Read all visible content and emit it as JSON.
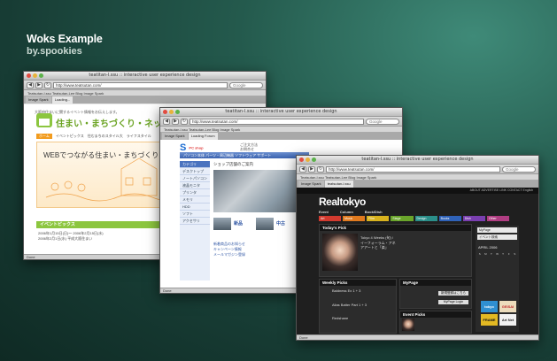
{
  "hero": {
    "title": "Woks Example",
    "subtitle": "by.spookies"
  },
  "windows": [
    {
      "title": "teatitan-l.ssu :: interactive user experience design",
      "url": "http://www.teatsutan.com/",
      "search": "Google",
      "bookmarks": "Teatsutan-l.ssu    Teatsutan-Lee Blog    Image Spark",
      "tabs": [
        "Image Spark",
        "Loading..."
      ],
      "status": "Done",
      "page": {
        "header_note": "大阪府住まいに関するイベント情報をお伝えします。",
        "brand": "住まい・まちづくり・ネット",
        "nav": [
          "ホーム",
          "イベントピックス",
          "住むまちのスタイル大",
          "ライフスタイル"
        ],
        "hero_text": "WEBでつながる住まい・まちづくり",
        "section": "イベントピックス",
        "news": [
          "2006年1月15日(日)〜 2006年2月15日(水)",
          "2006年2月1日(水) 平成大阪住まい"
        ]
      }
    },
    {
      "title": "teatitan-l.ssu :: interactive user experience design",
      "url": "http://www.teatsutan.com/",
      "search": "Google",
      "bookmarks": "Teatsutan-l.ssu    Teatsutan-Lee Blog    Image Spark",
      "tabs": [
        "Image Spark",
        "Loading Forum"
      ],
      "status": "Done",
      "page": {
        "logo": "S",
        "logo_tag": "PC shop",
        "top_links": [
          "ご注文方法",
          "お問合せ"
        ],
        "navbar": "パソコン本体   パーツ・周辺機器   ソフトウェア   サポート",
        "side_header": "カテゴリ",
        "side": [
          "デスクトップ",
          "ノートパソコン",
          "液晶モニタ",
          "プリンタ",
          "メモリ",
          "HDD",
          "ソフト",
          "アクセサリ"
        ],
        "photo_title": "ショップ店舗のご案内",
        "tiles": [
          "新品",
          "中古"
        ],
        "news": [
          "新着商品のお知らせ",
          "キャンペーン情報",
          "メールマガジン登録"
        ]
      }
    },
    {
      "title": "teatitan-l.ssu :: interactive user experience design",
      "url": "http://www.teatsutan.com/",
      "search": "Google",
      "bookmarks": "Teatsutan-l.ssu    Teatsutan-Lee Blog    Image Spark",
      "tabs": [
        "Image Spark",
        "teatsutan-l.ssu"
      ],
      "status": "Done",
      "page": {
        "top_bar": "ABOUT   ADVERTISE   LINK   CONTACT   English",
        "logo": "Realtokyo",
        "menu": [
          "Event",
          "Column",
          "Book/Dish"
        ],
        "cats": [
          "Art",
          "Music",
          "Film",
          "Stage",
          "Design",
          "Books",
          "Dish",
          "Other"
        ],
        "todays_pick": "Today's Pick",
        "pick_title": "Tokyo 4 Weeks (旬) / イーフォーラム・アネアアートと「楽」",
        "weekly_picks": "Weekly Picks",
        "weekly_items": [
          "Baldness Ex 1 + 3",
          "Alias Batter Part 1 + 3",
          "Redshane"
        ],
        "mypage": "MyPage",
        "mypage_btn": "新規登録はこちら",
        "mypage_login": "MyPage Login",
        "event_picks": "Event Picks",
        "side_buttons": [
          "MyPage",
          "イベント検索"
        ],
        "calendar_month": "APRIL 2006",
        "calendar_days": [
          "S",
          "M",
          "T",
          "W",
          "T",
          "F",
          "S"
        ],
        "ads": [
          "tokyo",
          "GEISAI",
          "FRAME",
          "Art Net"
        ]
      }
    }
  ]
}
